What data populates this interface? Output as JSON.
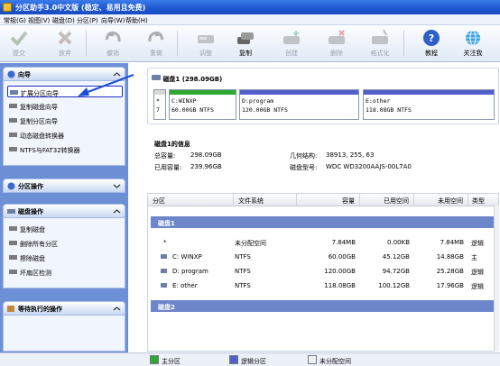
{
  "window": {
    "title": "分区助手3.0中文版 (稳定、易用且免费)"
  },
  "menu": [
    "常规(G)",
    "视图(V)",
    "磁盘(D)",
    "分区(P)",
    "向导(W)",
    "帮助(H)"
  ],
  "toolbar": {
    "items": [
      {
        "label": "提交",
        "icon": "check-icon",
        "enabled": false
      },
      {
        "label": "放弃",
        "icon": "discard-icon",
        "enabled": false
      },
      {
        "label": "撤销",
        "icon": "undo-icon",
        "enabled": false
      },
      {
        "label": "重做",
        "icon": "redo-icon",
        "enabled": false
      },
      {
        "label": "调整",
        "icon": "resize-disk-icon",
        "enabled": false
      },
      {
        "label": "复制",
        "icon": "copy-disk-icon",
        "enabled": true
      },
      {
        "label": "创建",
        "icon": "create-disk-icon",
        "enabled": false
      },
      {
        "label": "删除",
        "icon": "delete-disk-icon",
        "enabled": false
      },
      {
        "label": "格式化",
        "icon": "format-disk-icon",
        "enabled": false
      },
      {
        "label": "教程",
        "icon": "help-icon",
        "enabled": true
      },
      {
        "label": "关注我",
        "icon": "follow-icon",
        "enabled": true
      }
    ]
  },
  "sidebar": {
    "wizard": {
      "title": "向导",
      "items": [
        {
          "label": "扩展分区向导",
          "icon": "extend-partition-icon"
        },
        {
          "label": "复制磁盘向导",
          "icon": "copy-disk-wizard-icon"
        },
        {
          "label": "复制分区向导",
          "icon": "copy-partition-wizard-icon"
        },
        {
          "label": "动态磁盘转换器",
          "icon": "dynamic-disk-icon"
        },
        {
          "label": "NTFS与FAT32转换器",
          "icon": "ntfs-fat-icon"
        }
      ]
    },
    "partition_ops": {
      "title": "分区操作"
    },
    "disk_ops": {
      "title": "磁盘操作",
      "items": [
        {
          "label": "复制磁盘",
          "icon": "copy-disk-op-icon"
        },
        {
          "label": "删除所有分区",
          "icon": "delete-all-icon"
        },
        {
          "label": "擦除磁盘",
          "icon": "wipe-disk-icon"
        },
        {
          "label": "坏扇区检测",
          "icon": "bad-sector-icon"
        }
      ]
    },
    "pending": {
      "title": "等待执行的操作"
    }
  },
  "disk_map": {
    "title": "磁盘1 (298.09GB)",
    "partitions": [
      {
        "prefix": "*",
        "name": "",
        "size": "7",
        "bar_color": "#d8d8d8"
      },
      {
        "prefix": "",
        "name": "C:WINXP",
        "size": "60.00GB NTFS",
        "bar_color": "#2ea82e"
      },
      {
        "prefix": "",
        "name": "D:program",
        "size": "120.00GB NTFS",
        "bar_color": "#5060c8"
      },
      {
        "prefix": "",
        "name": "E:other",
        "size": "118.08GB NTFS",
        "bar_color": "#5060c8"
      }
    ]
  },
  "disk_info": {
    "title": "磁盘1的信息",
    "total_label": "总容量:",
    "total_value": "298.09GB",
    "used_label": "已用容量:",
    "used_value": "239.96GB",
    "geometry_label": "几何结构:",
    "geometry_value": "38913, 255, 63",
    "model_label": "磁盘型号:",
    "model_value": "WDC WD3200AAJS-00L7A0"
  },
  "table": {
    "headers": [
      "分区",
      "文件系统",
      "容量",
      "已用空间",
      "未用空间",
      "类型"
    ],
    "disk1_label": "磁盘1",
    "rows": [
      {
        "partition": "*",
        "fs": "未分配空间",
        "capacity": "7.84MB",
        "used": "0.00KB",
        "free": "7.84MB",
        "type": "逻辑"
      },
      {
        "partition": "C: WINXP",
        "fs": "NTFS",
        "capacity": "60.00GB",
        "used": "45.12GB",
        "free": "14.88GB",
        "type": "主"
      },
      {
        "partition": "D: program",
        "fs": "NTFS",
        "capacity": "120.00GB",
        "used": "94.72GB",
        "free": "25.28GB",
        "type": "逻辑"
      },
      {
        "partition": "E: other",
        "fs": "NTFS",
        "capacity": "118.08GB",
        "used": "100.12GB",
        "free": "17.96GB",
        "type": "逻辑"
      }
    ],
    "disk2_label": "磁盘2"
  },
  "legend": [
    {
      "label": "主分区",
      "color": "#2ea82e"
    },
    {
      "label": "逻辑分区",
      "color": "#5060c8"
    },
    {
      "label": "未分配空间",
      "color": "#f0f0f0"
    }
  ]
}
